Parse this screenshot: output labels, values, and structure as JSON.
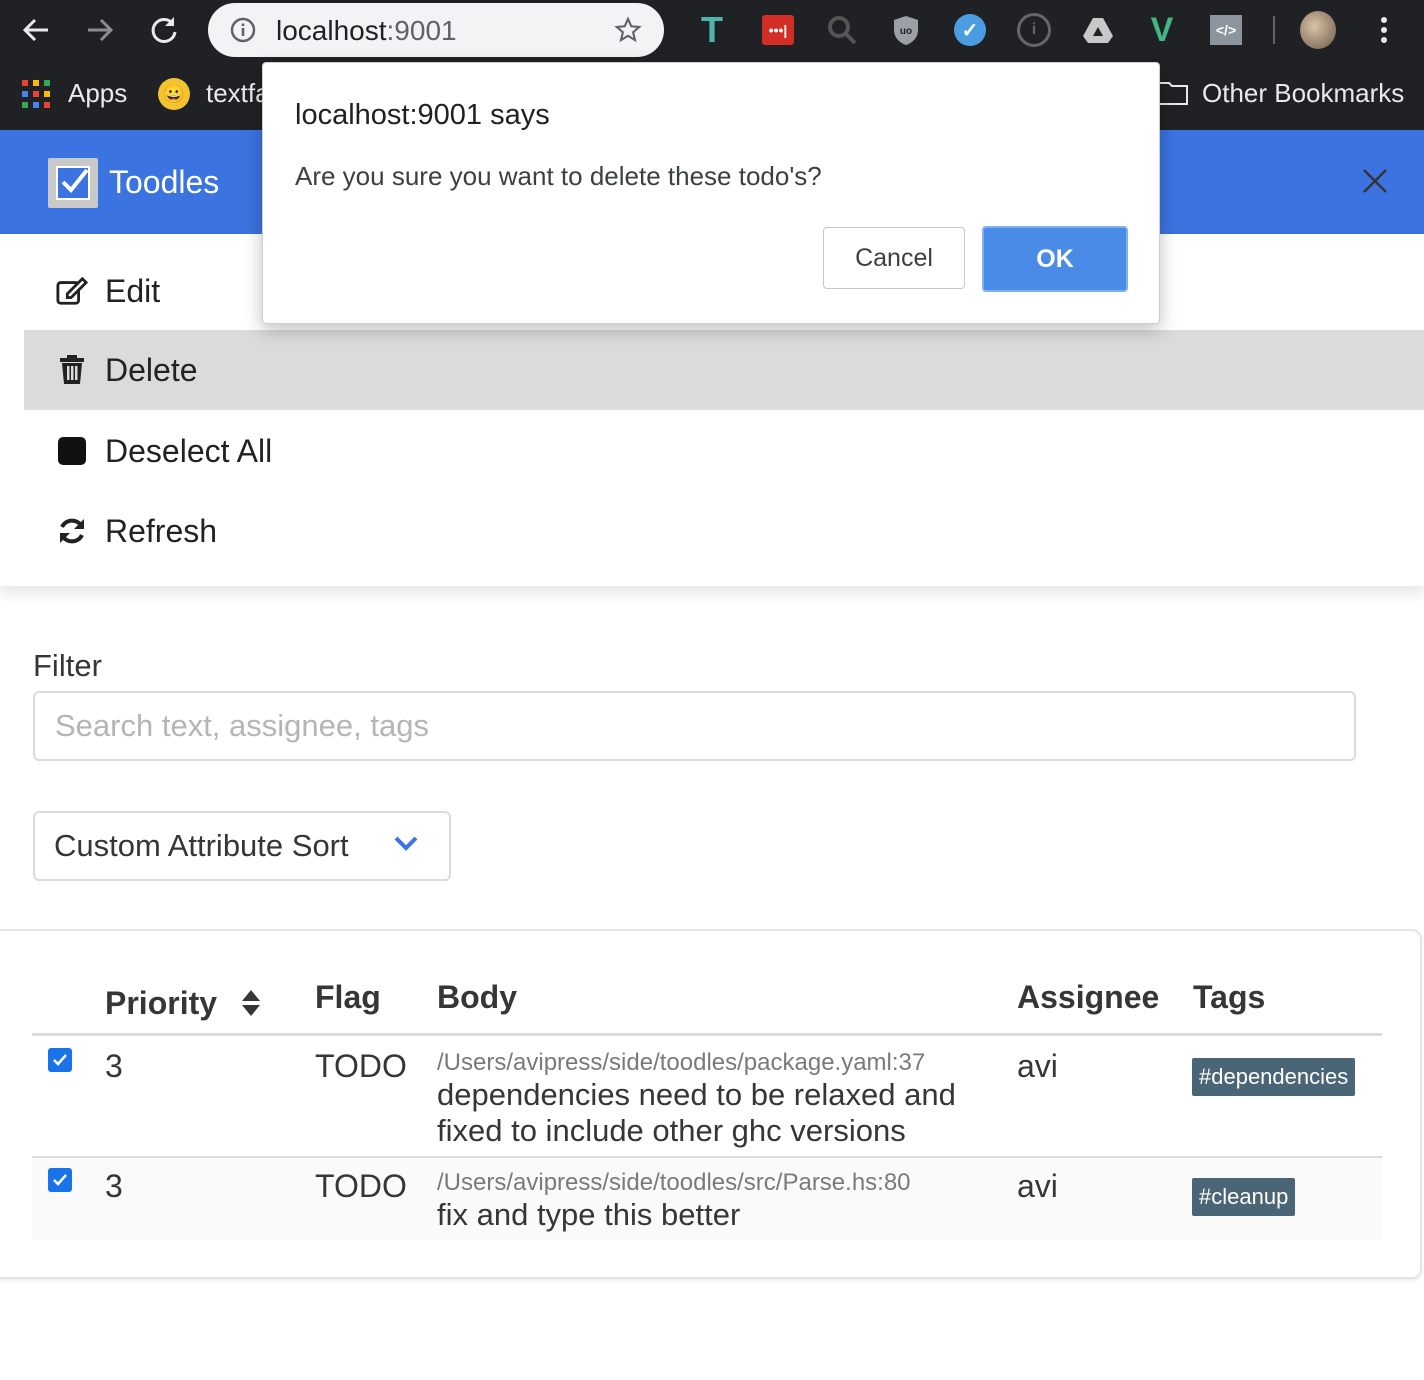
{
  "browser": {
    "url_host": "localhost",
    "url_port": ":9001",
    "bookmarks": {
      "apps": "Apps",
      "textfaces": "textfa",
      "other": "Other Bookmarks"
    }
  },
  "app": {
    "title": "Toodles",
    "colors": {
      "header": "#3b73e0",
      "tag": "#4a6576"
    }
  },
  "menu": {
    "items": [
      {
        "label": "Edit",
        "icon": "edit-icon"
      },
      {
        "label": "Delete",
        "icon": "trash-icon"
      },
      {
        "label": "Deselect All",
        "icon": "square-icon"
      },
      {
        "label": "Refresh",
        "icon": "refresh-icon"
      }
    ]
  },
  "filter": {
    "label": "Filter",
    "placeholder": "Search text, assignee, tags",
    "value": ""
  },
  "sort": {
    "selected": "Custom Attribute Sort"
  },
  "table": {
    "headers": {
      "priority": "Priority",
      "flag": "Flag",
      "body": "Body",
      "assignee": "Assignee",
      "tags": "Tags"
    },
    "rows": [
      {
        "checked": true,
        "priority": "3",
        "flag": "TODO",
        "path": "/Users/avipress/side/toodles/package.yaml:37",
        "body": "dependencies need to be relaxed and fixed to include other ghc versions",
        "assignee": "avi",
        "tag": "#dependencies"
      },
      {
        "checked": true,
        "priority": "3",
        "flag": "TODO",
        "path": "/Users/avipress/side/toodles/src/Parse.hs:80",
        "body": "fix and type this better",
        "assignee": "avi",
        "tag": "#cleanup"
      }
    ]
  },
  "dialog": {
    "title": "localhost:9001 says",
    "message": "Are you sure you want to delete these todo's?",
    "cancel": "Cancel",
    "ok": "OK"
  }
}
